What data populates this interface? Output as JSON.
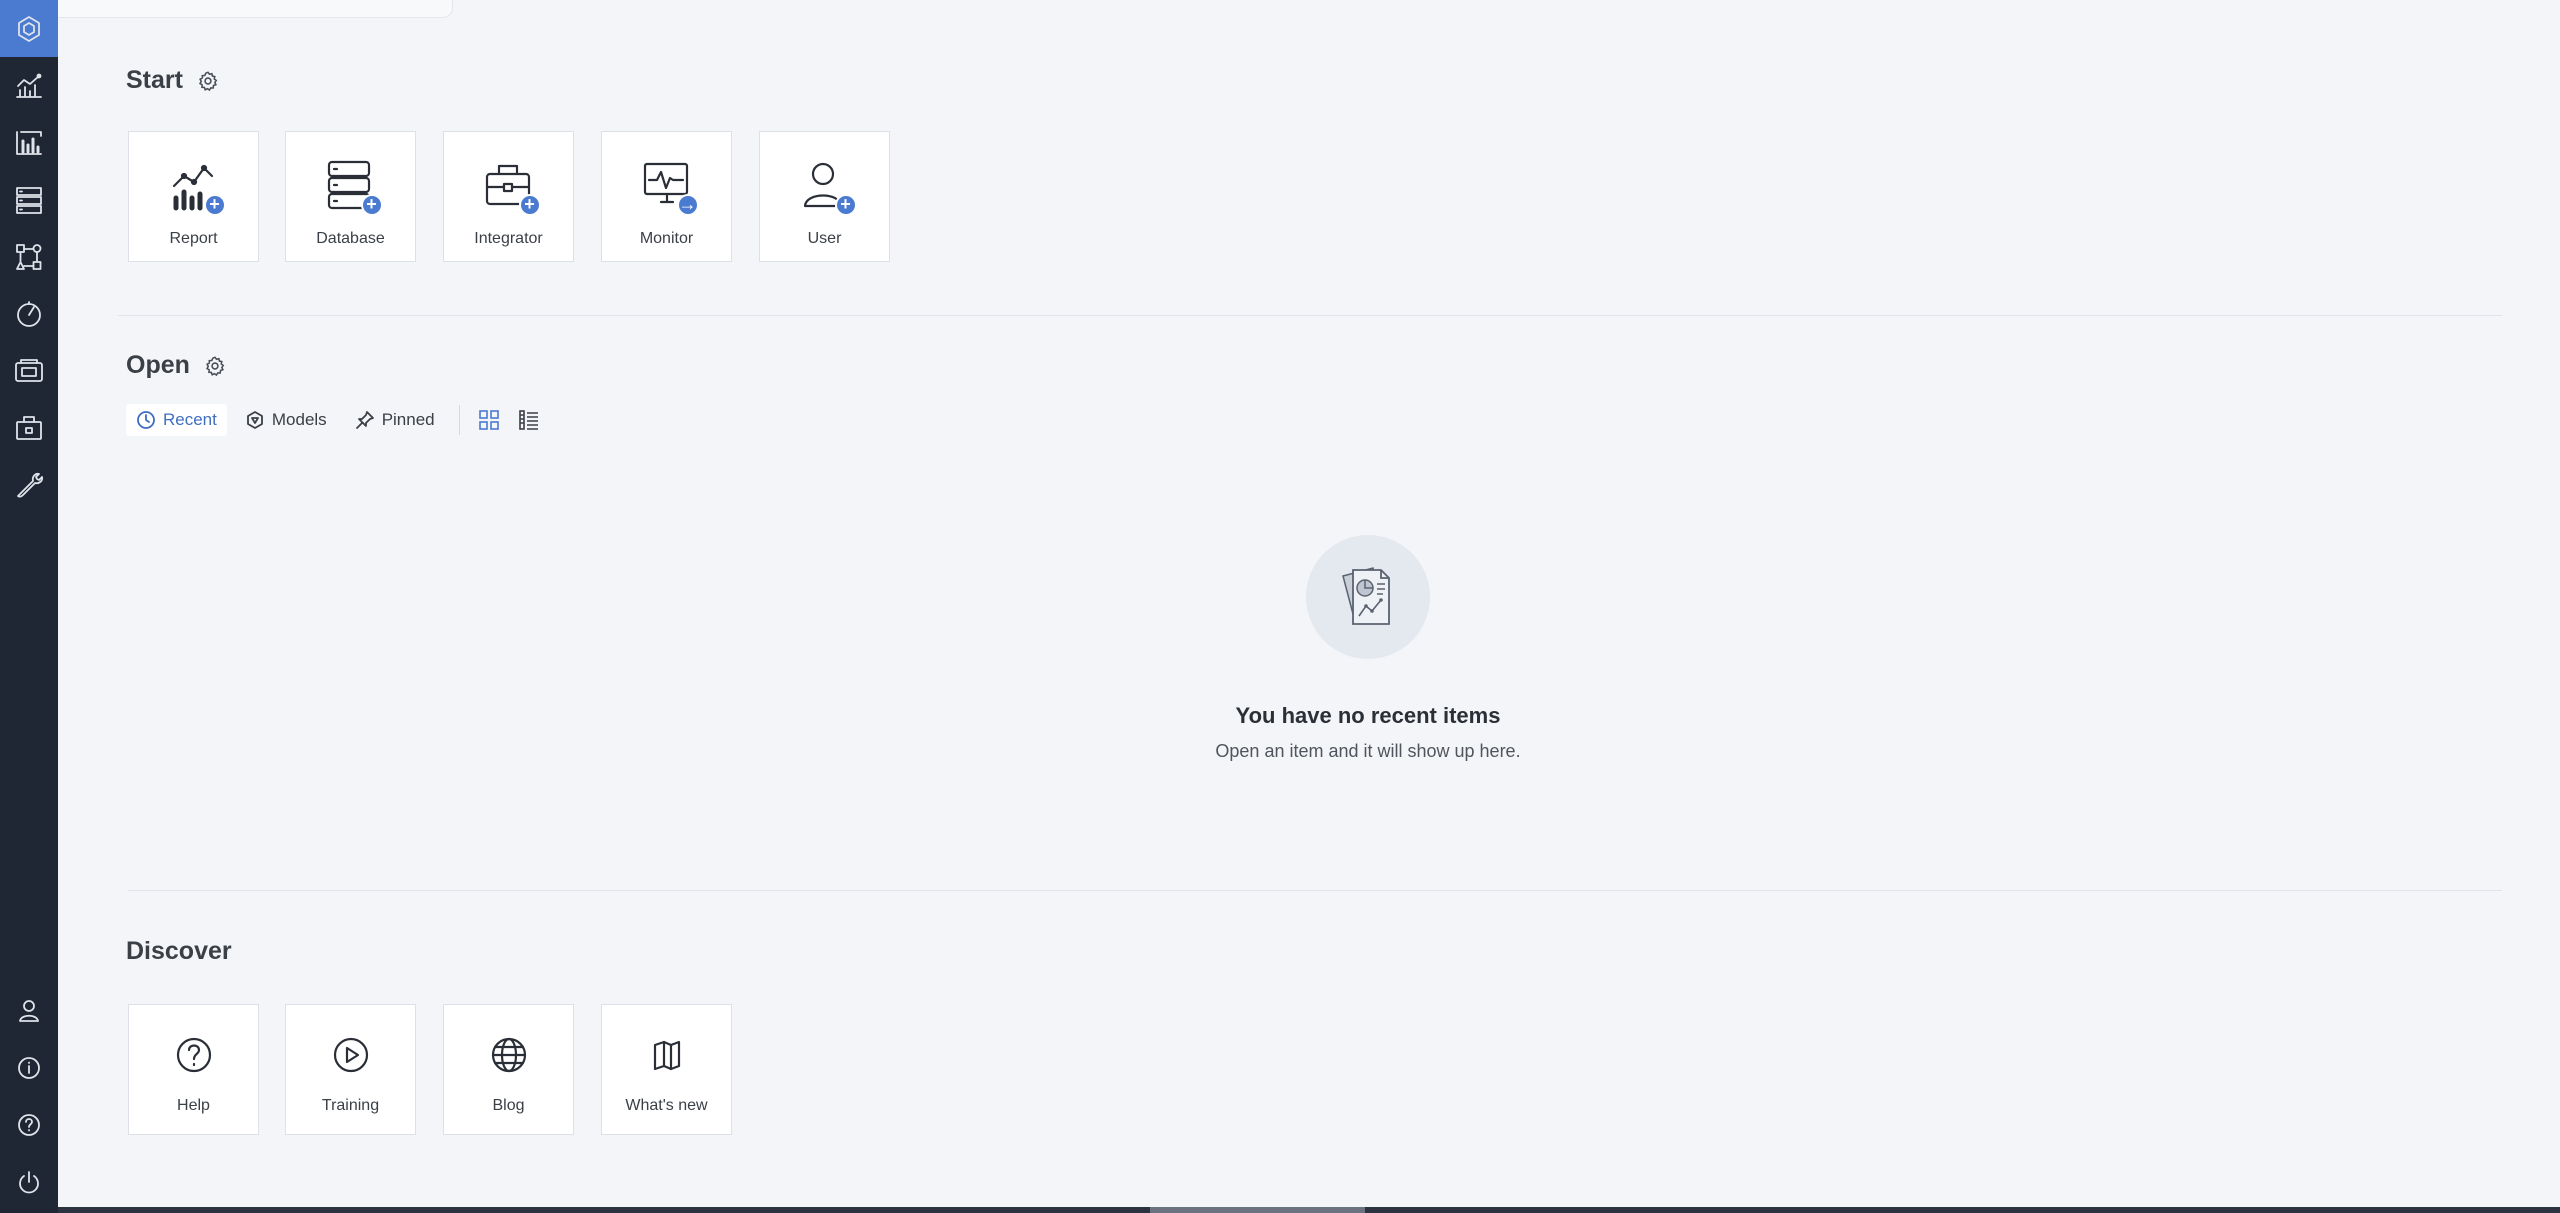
{
  "nav": {
    "items": [
      {
        "name": "home",
        "icon": "hexagon-icon"
      },
      {
        "name": "reports",
        "icon": "chart-line-icon"
      },
      {
        "name": "dashboards",
        "icon": "bar-chart-icon"
      },
      {
        "name": "databases",
        "icon": "server-rack-icon"
      },
      {
        "name": "models",
        "icon": "shapes-icon"
      },
      {
        "name": "monitor",
        "icon": "gauge-icon"
      },
      {
        "name": "integrator",
        "icon": "media-icon"
      },
      {
        "name": "jobs",
        "icon": "briefcase-icon"
      },
      {
        "name": "tools",
        "icon": "wrench-icon"
      }
    ],
    "bottom_items": [
      {
        "name": "account",
        "icon": "user-icon"
      },
      {
        "name": "about",
        "icon": "info-icon"
      },
      {
        "name": "help",
        "icon": "help-icon"
      },
      {
        "name": "logout",
        "icon": "power-icon"
      }
    ],
    "accent_color": "#4a7bd0"
  },
  "start": {
    "title": "Start",
    "tiles": [
      {
        "label": "Report",
        "icon": "report-chart-icon",
        "badge": "+"
      },
      {
        "label": "Database",
        "icon": "database-icon",
        "badge": "+"
      },
      {
        "label": "Integrator",
        "icon": "briefcase-icon",
        "badge": "+"
      },
      {
        "label": "Monitor",
        "icon": "monitor-icon",
        "badge": "→"
      },
      {
        "label": "User",
        "icon": "user-icon",
        "badge": "+"
      }
    ]
  },
  "open": {
    "title": "Open",
    "filters": [
      {
        "label": "Recent",
        "icon": "clock-icon",
        "active": true
      },
      {
        "label": "Models",
        "icon": "model-icon",
        "active": false
      },
      {
        "label": "Pinned",
        "icon": "pin-icon",
        "active": false
      }
    ],
    "view_modes": [
      "grid-view-icon",
      "list-view-icon"
    ],
    "empty": {
      "title": "You have no recent items",
      "subtitle": "Open an item and it will show up here."
    }
  },
  "discover": {
    "title": "Discover",
    "tiles": [
      {
        "label": "Help",
        "icon": "question-circle-icon"
      },
      {
        "label": "Training",
        "icon": "play-circle-icon"
      },
      {
        "label": "Blog",
        "icon": "globe-icon"
      },
      {
        "label": "What's new",
        "icon": "book-icon"
      }
    ]
  }
}
